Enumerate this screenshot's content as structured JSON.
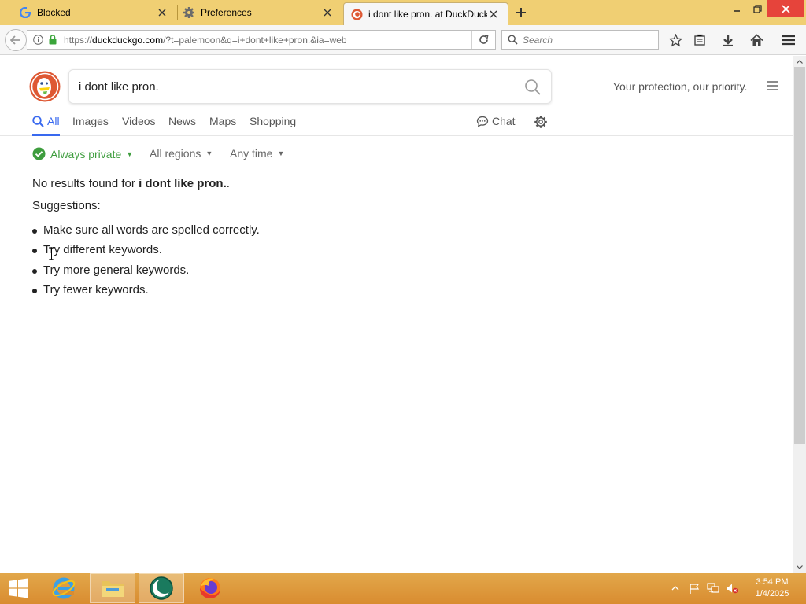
{
  "browser": {
    "tabs": [
      {
        "label": "Blocked",
        "icon": "google-icon",
        "active": false
      },
      {
        "label": "Preferences",
        "icon": "gear-icon",
        "active": false
      },
      {
        "label": "i dont like pron. at DuckDuckGo",
        "icon": "duckduckgo-icon",
        "active": true
      }
    ],
    "url": {
      "prefix": "https://",
      "host": "duckduckgo.com",
      "path": "/?t=palemoon&q=i+dont+like+pron.&ia=web"
    },
    "search_placeholder": "Search"
  },
  "ddg": {
    "query": "i dont like pron.",
    "tagline": "Your protection, our priority.",
    "tabs": {
      "all": "All",
      "images": "Images",
      "videos": "Videos",
      "news": "News",
      "maps": "Maps",
      "shopping": "Shopping",
      "chat": "Chat"
    },
    "filters": {
      "private": "Always private",
      "region": "All regions",
      "time": "Any time"
    },
    "no_results_prefix": "No results found for ",
    "no_results_query": "i dont like pron.",
    "no_results_suffix": ".",
    "suggestions_title": "Suggestions:",
    "suggestions": [
      "Make sure all words are spelled correctly.",
      "Try different keywords.",
      "Try more general keywords.",
      "Try fewer keywords."
    ]
  },
  "taskbar": {
    "clock_time": "3:54 PM",
    "clock_date": "1/4/2025"
  },
  "colors": {
    "titlebar": "#f0cf73",
    "taskbar": "#d98c30",
    "ddg_blue": "#3969ef",
    "private_green": "#3e9d3e"
  }
}
